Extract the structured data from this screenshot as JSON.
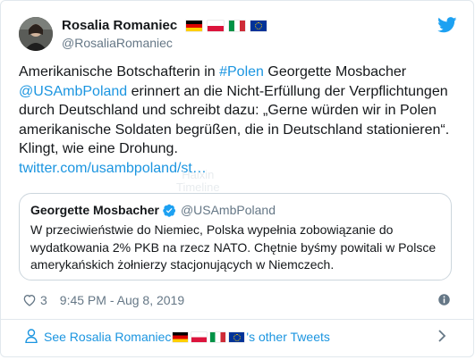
{
  "author": {
    "display_name": "Rosalia Romaniec",
    "flags": [
      "flag-germany",
      "flag-poland",
      "flag-italy",
      "flag-eu"
    ],
    "handle": "@RosaliaRomaniec"
  },
  "tweet": {
    "text_1": "Amerikanische Botschafterin in ",
    "hashtag": "#Polen",
    "text_2": " Georgette Mosbacher ",
    "mention": "@USAmbPoland",
    "text_3": " erinnert an die Nicht-Erfüllung der Verpflichtungen durch Deutschland und schreibt dazu: „Gerne würden wir in Polen amerikanische Soldaten begrüßen, die in Deutschland stationieren“. Klingt, wie eine Drohung.",
    "link": "twitter.com/usambpoland/st…"
  },
  "watermark": {
    "line1": "Haixin",
    "line2": "Timeline"
  },
  "quoted_tweet": {
    "name": "Georgette Mosbacher",
    "handle": "@USAmbPoland",
    "text": "W przeciwieństwie do Niemiec, Polska wypełnia zobowiązanie do wydatkowania 2% PKB na rzecz NATO.  Chętnie byśmy powitali w Polsce amerykańskich żołnierzy stacjonujących w Niemczech."
  },
  "meta": {
    "likes": "3",
    "timestamp": "9:45 PM - Aug 8, 2019"
  },
  "footer": {
    "prefix": "See Rosalia Romaniec",
    "suffix": "'s other Tweets"
  },
  "icons": {
    "twitter": "twitter-bird-icon",
    "heart": "heart-icon",
    "info": "info-icon",
    "verified": "verified-badge-icon",
    "user": "user-icon",
    "chevron": "chevron-right-icon"
  },
  "colors": {
    "link": "#1b95e0",
    "muted": "#657786",
    "border": "#e1e8ed",
    "twitter_blue": "#1da1f2"
  }
}
